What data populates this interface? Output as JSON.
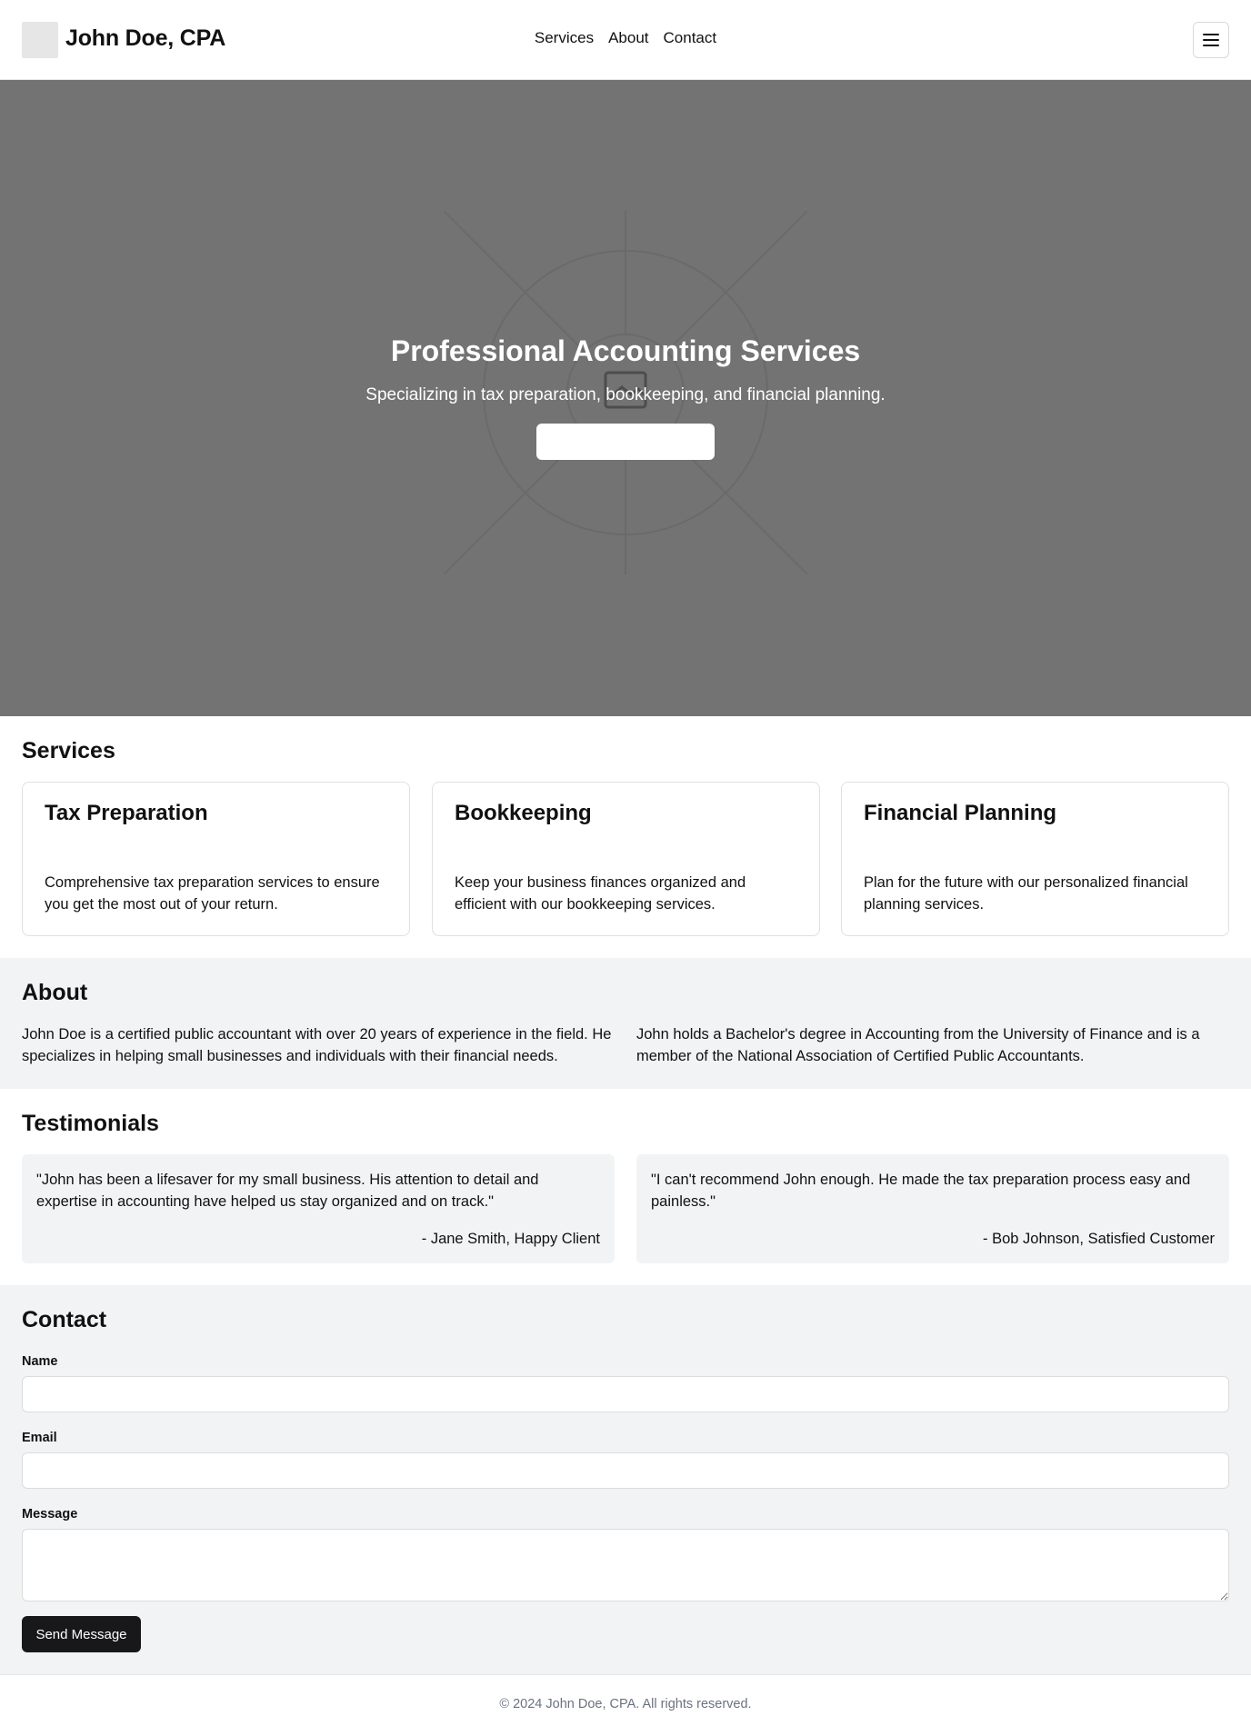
{
  "header": {
    "brand": "John Doe, CPA",
    "nav": [
      "Services",
      "About",
      "Contact"
    ]
  },
  "hero": {
    "title": "Professional Accounting Services",
    "subtitle": "Specializing in tax preparation, bookkeeping, and financial planning.",
    "background_color": "#737373"
  },
  "services": {
    "title": "Services",
    "cards": [
      {
        "title": "Tax Preparation",
        "description": "Comprehensive tax preparation services to ensure you get the most out of your return."
      },
      {
        "title": "Bookkeeping",
        "description": "Keep your business finances organized and efficient with our bookkeeping services."
      },
      {
        "title": "Financial Planning",
        "description": "Plan for the future with our personalized financial planning services."
      }
    ]
  },
  "about": {
    "title": "About",
    "paragraphs": [
      "John Doe is a certified public accountant with over 20 years of experience in the field. He specializes in helping small businesses and individuals with their financial needs.",
      "John holds a Bachelor's degree in Accounting from the University of Finance and is a member of the National Association of Certified Public Accountants."
    ]
  },
  "testimonials": {
    "title": "Testimonials",
    "items": [
      {
        "quote": "\"John has been a lifesaver for my small business. His attention to detail and expertise in accounting have helped us stay organized and on track.\"",
        "author": "- Jane Smith, Happy Client"
      },
      {
        "quote": "\"I can't recommend John enough. He made the tax preparation process easy and painless.\"",
        "author": "- Bob Johnson, Satisfied Customer"
      }
    ]
  },
  "contact": {
    "title": "Contact",
    "name_label": "Name",
    "email_label": "Email",
    "message_label": "Message",
    "name_value": "",
    "email_value": "",
    "message_value": "",
    "submit_label": "Send Message"
  },
  "footer": {
    "text": "© 2024 John Doe, CPA. All rights reserved."
  },
  "icons": {
    "menu": "hamburger-menu-icon",
    "hero": "image-placeholder-icon",
    "logo": "logo-placeholder"
  },
  "colors": {
    "primary_button": "#18181b",
    "section_alt_bg": "#f2f3f5",
    "footer_text": "#6b7280"
  }
}
